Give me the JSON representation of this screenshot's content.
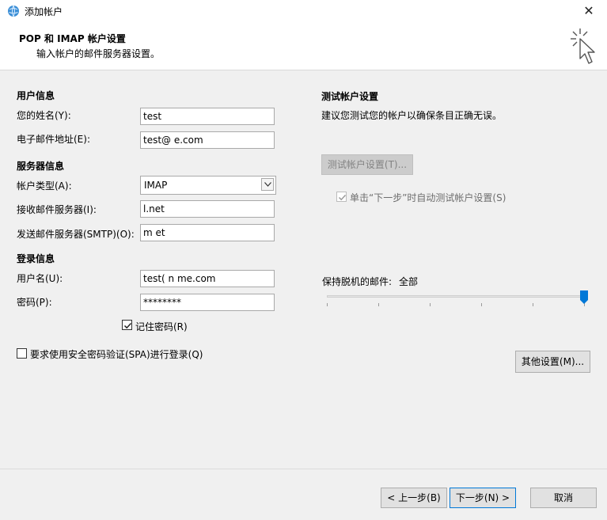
{
  "window": {
    "title": "添加帐户",
    "close_glyph": "✕"
  },
  "header": {
    "title": "POP 和 IMAP 帐户设置",
    "subtitle": "输入帐户的邮件服务器设置。"
  },
  "user_info": {
    "heading": "用户信息",
    "name_label": "您的姓名(Y):",
    "name_value": "test",
    "email_label": "电子邮件地址(E):",
    "email_value": "test@          e.com"
  },
  "server_info": {
    "heading": "服务器信息",
    "account_type_label": "帐户类型(A):",
    "account_type_value": "IMAP",
    "incoming_label": "接收邮件服务器(I):",
    "incoming_value": "          l.net",
    "outgoing_label": "发送邮件服务器(SMTP)(O):",
    "outgoing_value": "         m     et"
  },
  "login_info": {
    "heading": "登录信息",
    "username_label": "用户名(U):",
    "username_value": "test(     n   me.com",
    "password_label": "密码(P):",
    "password_value": "********",
    "remember_label": "记住密码(R)",
    "remember_checked": true
  },
  "spa": {
    "label": "要求使用安全密码验证(SPA)进行登录(Q)",
    "checked": false
  },
  "test_settings": {
    "heading": "测试帐户设置",
    "description": "建议您测试您的帐户以确保条目正确无误。",
    "test_button": "测试帐户设置(T)...",
    "auto_test_label": "单击“下一步”时自动测试帐户设置(S)",
    "auto_test_checked": true
  },
  "offline": {
    "label": "保持脱机的邮件:",
    "value": "全部",
    "slider_fraction": 1.0
  },
  "more_settings_button": "其他设置(M)...",
  "footer": {
    "back": "< 上一步(B)",
    "next": "下一步(N) >",
    "cancel": "取消"
  }
}
